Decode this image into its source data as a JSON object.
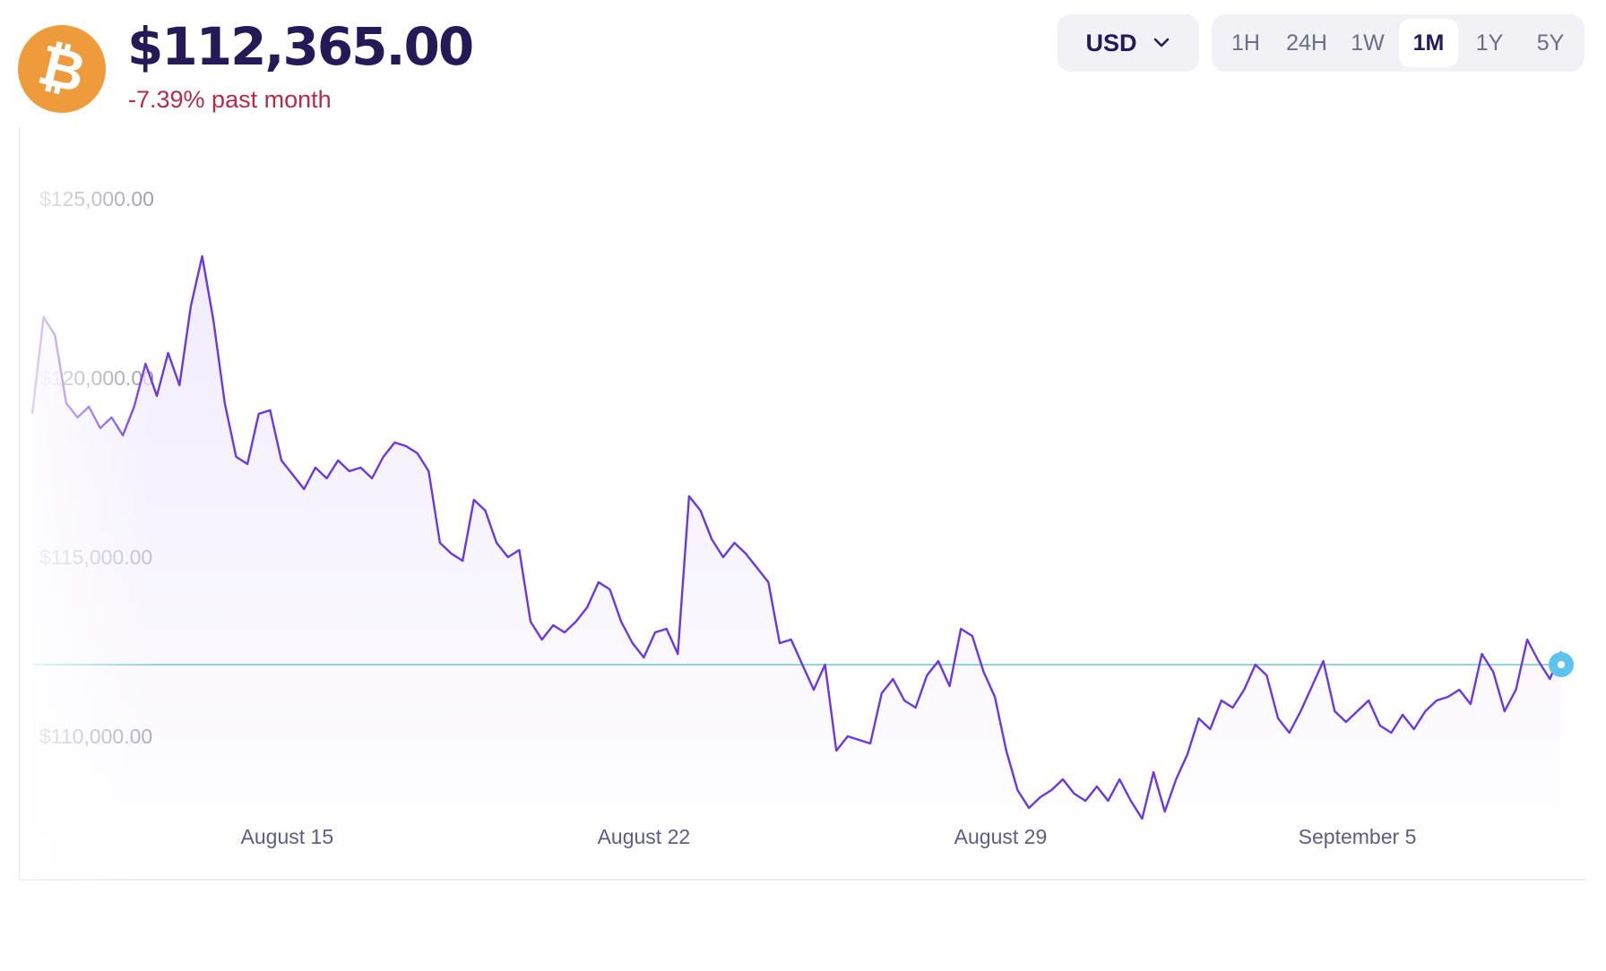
{
  "header": {
    "price": "$112,365.00",
    "change": "-7.39% past month",
    "logo_icon": "bitcoin-icon",
    "logo_glyph": "₿"
  },
  "controls": {
    "currency": "USD",
    "ranges": [
      "1H",
      "24H",
      "1W",
      "1M",
      "1Y",
      "5Y"
    ],
    "active_range": "1M"
  },
  "colors": {
    "title": "#251958",
    "negative": "#b82a48",
    "line": "#6a38e0",
    "fill": "#efe8fd",
    "reference_line": "#6ec6d6",
    "current_marker": "#5fc3ef",
    "axis_text": "#9d9caf",
    "date_text": "#5f5d80",
    "bitcoin": "#ee9b3c",
    "tab_text": "#6e6d86",
    "tab_active_text": "#251958"
  },
  "chart_data": {
    "type": "line",
    "series": [
      {
        "values": [
          119000,
          121700,
          121200,
          119300,
          118900,
          119200,
          118600,
          118900,
          118400,
          119200,
          120400,
          119500,
          120700,
          119800,
          122000,
          123400,
          121600,
          119300,
          117800,
          117600,
          119000,
          119100,
          117700,
          117300,
          116900,
          117500,
          117200,
          117700,
          117400,
          117500,
          117200,
          117800,
          118200,
          118100,
          117900,
          117400,
          115400,
          115100,
          114900,
          116600,
          116300,
          115400,
          115000,
          115200,
          113200,
          112700,
          113100,
          112900,
          113200,
          113600,
          114300,
          114100,
          113200,
          112600,
          112200,
          112900,
          113000,
          112300,
          116700,
          116300,
          115500,
          115000,
          115400,
          115100,
          114700,
          114300,
          112600,
          112700,
          112000,
          111300,
          112000,
          109600,
          110000,
          109900,
          109800,
          111200,
          111600,
          111000,
          110800,
          111700,
          112100,
          111400,
          113000,
          112800,
          111800,
          111100,
          109600,
          108500,
          108000,
          108300,
          108500,
          108800,
          108400,
          108200,
          108600,
          108200,
          108800,
          108200,
          107700,
          109000,
          107900,
          108800,
          109500,
          110500,
          110200,
          111000,
          110800,
          111300,
          112000,
          111700,
          110500,
          110100,
          110700,
          111400,
          112100,
          110700,
          110400,
          110700,
          111000,
          110300,
          110100,
          110600,
          110200,
          110700,
          111000,
          111100,
          111300,
          110900,
          112300,
          111800,
          110700,
          111300,
          112700,
          112100,
          111600,
          112365
        ]
      }
    ],
    "xlim": [
      "2025-08-10",
      "2025-09-09"
    ],
    "x_ticks": [
      "August 15",
      "August 22",
      "August 29",
      "September 5"
    ],
    "x_tick_dates": [
      "2025-08-15",
      "2025-08-22",
      "2025-08-29",
      "2025-09-05"
    ],
    "ylim": [
      106000,
      126300
    ],
    "y_ticks": [
      125000,
      120000,
      115000,
      110000
    ],
    "y_tick_labels": [
      "$125,000.00",
      "$120,000.00",
      "$115,000.00",
      "$110,000.00"
    ],
    "reference_line": 112000,
    "current_value": 112365,
    "grid": false
  }
}
